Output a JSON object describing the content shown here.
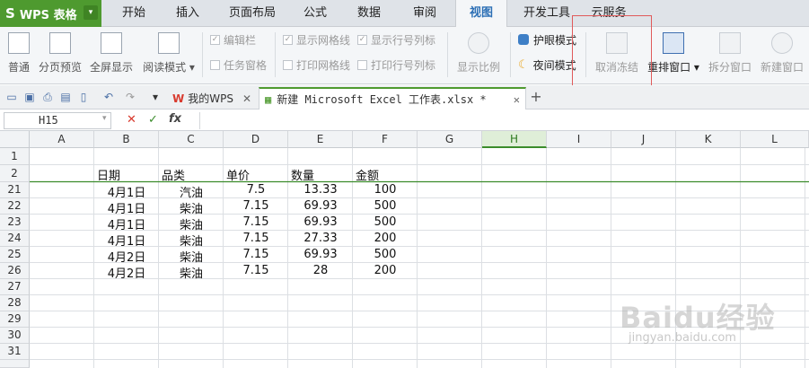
{
  "app": {
    "logo": "S",
    "name": "WPS 表格",
    "drop": "▾"
  },
  "menu": [
    "开始",
    "插入",
    "页面布局",
    "公式",
    "数据",
    "审阅",
    "视图",
    "开发工具",
    "云服务"
  ],
  "active_menu_index": 6,
  "ribbon": {
    "normal": "普通",
    "page_break": "分页预览",
    "full_screen": "全屏显示",
    "reading_mode": "阅读模式",
    "edit_bar": "编辑栏",
    "task_pane": "任务窗格",
    "show_gridlines": "显示网格线",
    "print_gridlines": "打印网格线",
    "show_headers": "显示行号列标",
    "print_headers": "打印行号列标",
    "zoom": "显示比例",
    "eye_mode": "护眼模式",
    "night_mode": "夜间模式",
    "unfreeze": "取消冻结",
    "arrange": "重排窗口",
    "split": "拆分窗口",
    "new_window": "新建窗口"
  },
  "tabs": [
    {
      "label": "我的WPS"
    },
    {
      "label": "新建 Microsoft Excel 工作表.xlsx *"
    }
  ],
  "namebox": "H15",
  "fx": "fx",
  "columns": [
    "A",
    "B",
    "C",
    "D",
    "E",
    "F",
    "G",
    "H",
    "I",
    "J",
    "K",
    "L"
  ],
  "selected_column": "H",
  "header_row": {
    "row": "2",
    "cells": [
      "日期",
      "品类",
      "单价",
      "数量",
      "金额"
    ]
  },
  "rows": [
    {
      "row": "21",
      "date": "4月1日",
      "cat": "汽油",
      "price": "7.5",
      "qty": "13.33",
      "amt": "100"
    },
    {
      "row": "22",
      "date": "4月1日",
      "cat": "柴油",
      "price": "7.15",
      "qty": "69.93",
      "amt": "500"
    },
    {
      "row": "23",
      "date": "4月1日",
      "cat": "柴油",
      "price": "7.15",
      "qty": "69.93",
      "amt": "500"
    },
    {
      "row": "24",
      "date": "4月1日",
      "cat": "柴油",
      "price": "7.15",
      "qty": "27.33",
      "amt": "200"
    },
    {
      "row": "25",
      "date": "4月2日",
      "cat": "柴油",
      "price": "7.15",
      "qty": "69.93",
      "amt": "500"
    },
    {
      "row": "26",
      "date": "4月2日",
      "cat": "柴油",
      "price": "7.15",
      "qty": "28",
      "amt": "200"
    }
  ],
  "row_numbers_top": [
    "1",
    "2"
  ],
  "row_numbers_bottom": [
    "27",
    "28",
    "29",
    "30",
    "31"
  ],
  "watermark": {
    "brand": "Baidu经验",
    "url": "jingyan.baidu.com"
  }
}
